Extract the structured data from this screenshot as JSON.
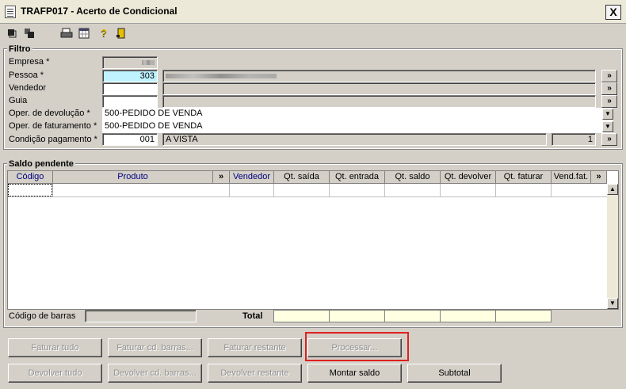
{
  "window": {
    "title": "TRAFP017 - Acerto de Condicional",
    "close_label": "X"
  },
  "toolbar": {
    "icons": [
      "expand-icon",
      "collapse-icon",
      "print-icon",
      "calendar-icon",
      "help-icon",
      "exit-door-icon"
    ]
  },
  "filtro": {
    "title": "Filtro",
    "empresa_label": "Empresa *",
    "pessoa_label": "Pessoa *",
    "pessoa_code": "303",
    "vendedor_label": "Vendedor",
    "guia_label": "Guia",
    "oper_devolucao_label": "Oper. de devolução *",
    "oper_devolucao_value": "500-PEDIDO DE VENDA",
    "oper_faturamento_label": "Oper. de faturamento *",
    "oper_faturamento_value": "500-PEDIDO DE VENDA",
    "condicao_label": "Condição pagamento *",
    "condicao_code": "001",
    "condicao_desc": "A VISTA",
    "condicao_count": "1",
    "lookup_label": "»"
  },
  "saldo": {
    "title": "Saldo pendente",
    "columns": [
      "Código",
      "Produto",
      "»",
      "Vendedor",
      "Qt. saída",
      "Qt. entrada",
      "Qt. saldo",
      "Qt. devolver",
      "Qt. faturar",
      "Vend.fat.",
      "»"
    ],
    "barcode_label": "Código de barras",
    "total_label": "Total"
  },
  "buttons": {
    "faturar_tudo": "Faturar tudo",
    "faturar_cd_barras": "Faturar cd. barras...",
    "faturar_restante": "Faturar restante",
    "processar": "Processar...",
    "devolver_tudo": "Devolver tudo",
    "devolver_cd_barras": "Devolver cd. barras...",
    "devolver_restante": "Devolver restante",
    "montar_saldo": "Montar saldo",
    "subtotal": "Subtotal"
  },
  "colors": {
    "highlight": "#e02020",
    "required_field": "#bff3ff",
    "total_field": "#ffffe1"
  }
}
